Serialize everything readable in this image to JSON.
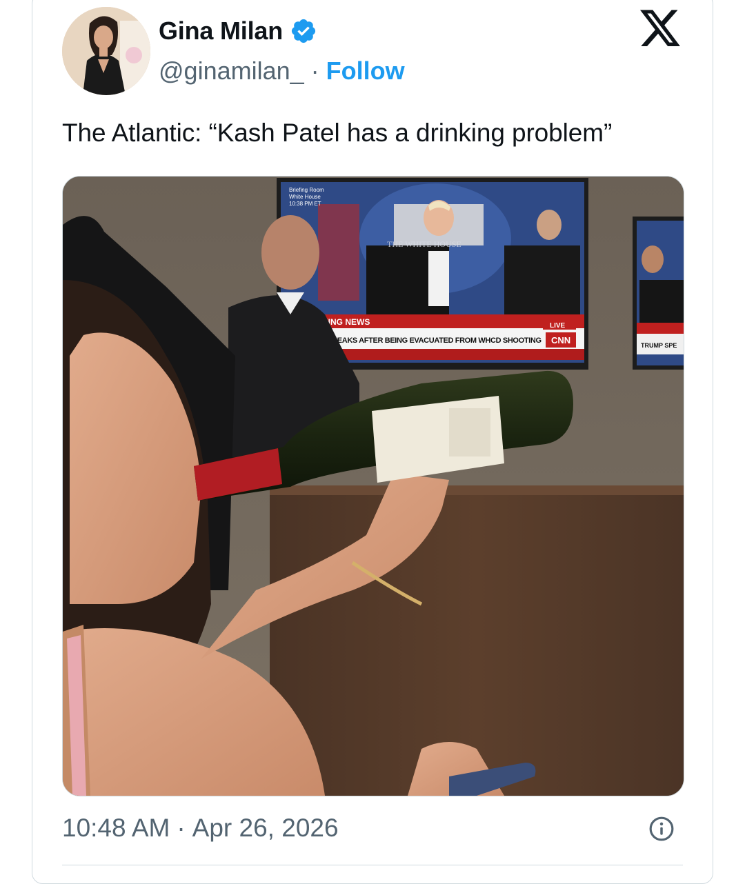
{
  "author": {
    "display_name": "Gina Milan",
    "handle": "@ginamilan_",
    "verified": true,
    "follow_label": "Follow"
  },
  "separator": "·",
  "tweet": {
    "text": "The Atlantic: “Kash Patel has a drinking problem”"
  },
  "media": {
    "tv_banner": "BREAKING NEWS",
    "tv_headline": "TRUMP SPEAKS AFTER BEING EVACUATED FROM WHCD SHOOTING",
    "tv_network": "CNN",
    "tv_live": "LIVE",
    "tv_corner_lines": [
      "Briefing Room",
      "White House",
      "10:38 PM ET"
    ],
    "tv_podium_text": "THE WHITE HOUSE",
    "tv2_headline": "TRUMP SPE"
  },
  "timestamp": {
    "time": "10:48 AM",
    "date": "Apr 26, 2026"
  },
  "colors": {
    "accent": "#1d9bf0",
    "secondary_text": "#536471",
    "border": "#cfd9de"
  },
  "icons": {
    "close": "x-logo-icon",
    "verified": "verified-badge-icon",
    "info": "info-icon"
  }
}
